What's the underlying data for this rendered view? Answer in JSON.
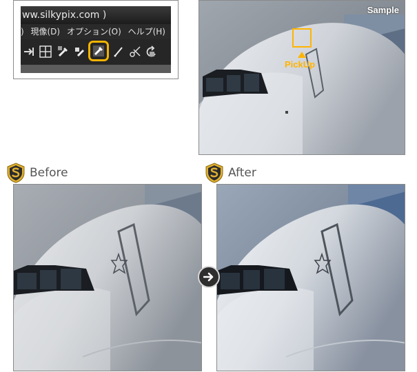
{
  "toolbar_crop": {
    "title": "ww.silkypix.com )",
    "menu": [
      ") ",
      "現像(D)",
      "オプション(O)",
      "ヘルプ(H)"
    ],
    "tools": [
      "arrow-right-icon",
      "grid-icon",
      "eyedropper-icon",
      "brush-eraser-icon",
      "pickup-tool-icon",
      "pen-icon",
      "scissors-icon",
      "rotate-icon"
    ],
    "highlighted_tool": "pickup-tool-icon",
    "highlight_color": "#f2b400"
  },
  "sample": {
    "label": "Sample",
    "pickup_label": "PickUp",
    "accent": "#ffb400"
  },
  "before": {
    "title": "Before"
  },
  "after": {
    "title": "After"
  },
  "colors": {
    "badge_gold": "#e0b030",
    "badge_dark": "#2b2b2b",
    "heading": "#555555"
  }
}
